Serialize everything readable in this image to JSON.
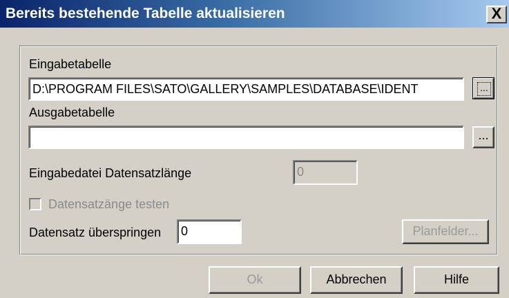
{
  "window": {
    "title": "Bereits bestehende Tabelle aktualisieren",
    "close_label": "X"
  },
  "input_table": {
    "label": "Eingabetabelle",
    "value": "D:\\PROGRAM FILES\\SATO\\GALLERY\\SAMPLES\\DATABASE\\IDENT",
    "browse_label": "..."
  },
  "output_table": {
    "label": "Ausgabetabelle",
    "value": "",
    "browse_label": "..."
  },
  "record_length": {
    "label": "Eingabedatei Datensatzlänge",
    "value": "0"
  },
  "test_record": {
    "label": "Datensatzänge testen",
    "checked": false,
    "enabled": false
  },
  "skip_record": {
    "label": "Datensatz überspringen",
    "value": "0"
  },
  "buttons": {
    "planfelder": "Planfelder...",
    "ok": "Ok",
    "cancel": "Abbrechen",
    "help": "Hilfe"
  },
  "colors": {
    "title_gradient_start": "#0a246a",
    "title_gradient_end": "#a6caf0",
    "face": "#d4d0c8"
  }
}
